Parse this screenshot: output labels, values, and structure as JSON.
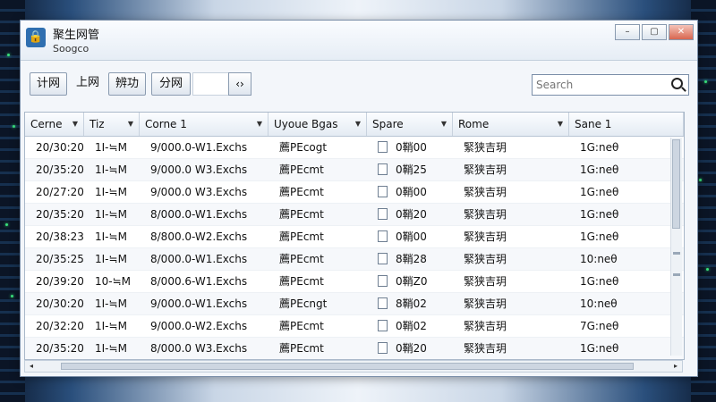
{
  "window": {
    "title": "聚生网管",
    "subtitle": "Soogco",
    "controls": [
      "–",
      "▢",
      "✕"
    ]
  },
  "toolbar": {
    "buttons": [
      "计网",
      "上网",
      "辨功",
      "分网"
    ],
    "arrow": "‹›",
    "search_placeholder": "Search"
  },
  "table": {
    "columns": [
      "Cerne",
      "Tiz",
      "Corne 1",
      "Uyoue Bgas",
      "Spare",
      "Rome",
      "Sane 1"
    ],
    "rows": [
      [
        "20/30:20",
        "1I-≒M",
        "9/000.0-W1.Exchs",
        "薦PEcogt",
        "0鞘00",
        "緊狭吉玥",
        "1G:neθ"
      ],
      [
        "20/35:20",
        "1I-≒M",
        "9/000.0 W3.Exchs",
        "薦PEcmt",
        "0鞘25",
        "緊狭吉玥",
        "1G:neθ"
      ],
      [
        "20/27:20",
        "1I-≒M",
        "9/000.0 W3.Exchs",
        "薦PEcmt",
        "0鞘00",
        "緊狭吉玥",
        "1G:neθ"
      ],
      [
        "20/35:20",
        "1I-≒M",
        "8/000.0-W1.Exchs",
        "薦PEcmt",
        "0鞘20",
        "緊狭吉玥",
        "1G:neθ"
      ],
      [
        "20/38:23",
        "1I-≒M",
        "8/800.0-W2.Exchs",
        "薦PEcmt",
        "0鞘00",
        "緊狭吉玥",
        "1G:neθ"
      ],
      [
        "20/35:25",
        "1I-≒M",
        "8/000.0-W1.Exchs",
        "薦PEcmt",
        "8鞘28",
        "緊狭吉玥",
        "10:neθ"
      ],
      [
        "20/39:20",
        "10-≒M",
        "8/000.6-W1.Exchs",
        "薦PEcmt",
        "0鞘Z0",
        "緊狭吉玥",
        "1G:neθ"
      ],
      [
        "20/30:20",
        "1I-≒M",
        "9/000.0-W1.Exchs",
        "薦PEcngt",
        "8鞘02",
        "緊狭吉玥",
        "10:neθ"
      ],
      [
        "20/32:20",
        "1I-≒M",
        "9/000.0-W2.Exchs",
        "薦PEcmt",
        "0鞘02",
        "緊狭吉玥",
        "7G:neθ"
      ],
      [
        "20/35:20",
        "1I-≒M",
        "8/000.0 W3.Exchs",
        "薦PEcmt",
        "0鞘20",
        "緊狭吉玥",
        "1G:neθ"
      ]
    ]
  },
  "scroll": {
    "left_arrow": "◂",
    "right_arrow": "▸"
  }
}
